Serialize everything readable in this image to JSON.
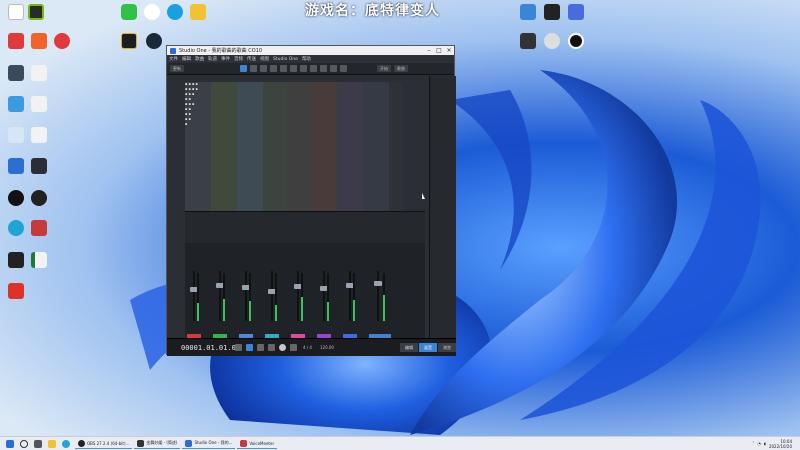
{
  "overlay_title": "游戏名：底特律变人",
  "app": {
    "title": "Studio One - 我的歌曲的歌曲 CO10",
    "menu": [
      "文件",
      "编辑",
      "歌曲",
      "轨道",
      "事件",
      "音频",
      "传送",
      "视图",
      "Studio One",
      "帮助"
    ],
    "toolbar_left_label": "更新",
    "toolbar_right": [
      "开始",
      "歌曲"
    ],
    "timecode": "00001.01.01.00",
    "time_sig": "4 / 4",
    "tempo": "120.00",
    "tabs": [
      "编辑",
      "混音",
      "浏览"
    ]
  },
  "taskbar": {
    "tasks": [
      "OBS 27.2.4 (64-bit)...",
      "金舞妙媛 - (简述)",
      "Studio One - 我的...",
      "VoiceMeeter"
    ],
    "time": "10:04",
    "date": "2022/10/20"
  },
  "colors": {
    "strips": [
      "#d63a3a",
      "#2fb84a",
      "#4a8be0",
      "#29b0c4",
      "#e04a9a",
      "#9b43d6",
      "#3b6ee0",
      "#3a86d6"
    ],
    "accent": "#3a86d6"
  }
}
